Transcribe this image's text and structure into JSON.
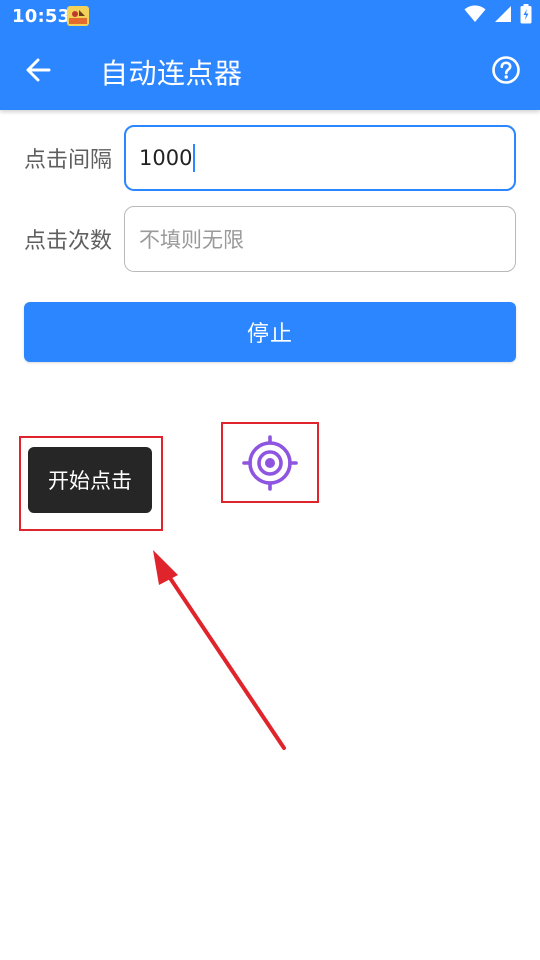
{
  "status_bar": {
    "time": "10:53",
    "app_icon": "app-notification-icon",
    "icons": [
      "wifi-icon",
      "cellular-signal-icon",
      "battery-charging-icon"
    ]
  },
  "app_bar": {
    "title": "自动连点器",
    "back_icon": "back-arrow-icon",
    "help_icon": "help-icon"
  },
  "form": {
    "interval": {
      "label": "点击间隔",
      "value": "1000",
      "placeholder": ""
    },
    "count": {
      "label": "点击次数",
      "value": "",
      "placeholder": "不填则无限"
    }
  },
  "stop_button": {
    "label": "停止"
  },
  "floating": {
    "start_button_label": "开始点击",
    "target_icon": "crosshair-target-icon"
  },
  "colors": {
    "primary": "#2b86ff",
    "annotation_red": "#e0242c",
    "target_purple": "#8e55e0",
    "start_button_bg": "#262626"
  }
}
